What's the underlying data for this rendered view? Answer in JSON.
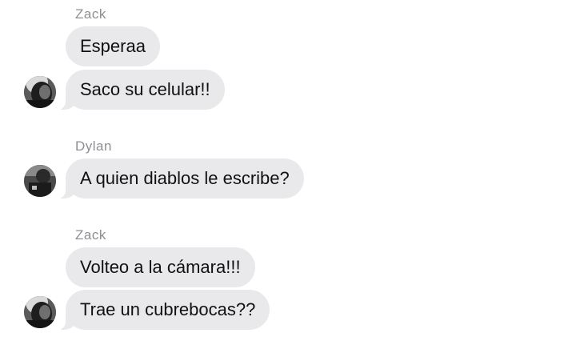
{
  "messages": [
    {
      "sender": "Zack",
      "text": "Esperaa",
      "avatar": false
    },
    {
      "sender": null,
      "text": "Saco su celular!!",
      "avatar": true
    },
    {
      "sender": "Dylan",
      "text": "A quien diablos le escribe?",
      "avatar": true
    },
    {
      "sender": "Zack",
      "text": "Volteo a la cámara!!!",
      "avatar": false
    },
    {
      "sender": null,
      "text": "Trae un cubrebocas??",
      "avatar": true
    }
  ],
  "colors": {
    "bubble": "#e9e9eb",
    "sender": "#8e8e93",
    "text": "#111111"
  },
  "icons": {
    "avatar_zack": "profile-photo-icon",
    "avatar_dylan": "profile-photo-icon"
  }
}
